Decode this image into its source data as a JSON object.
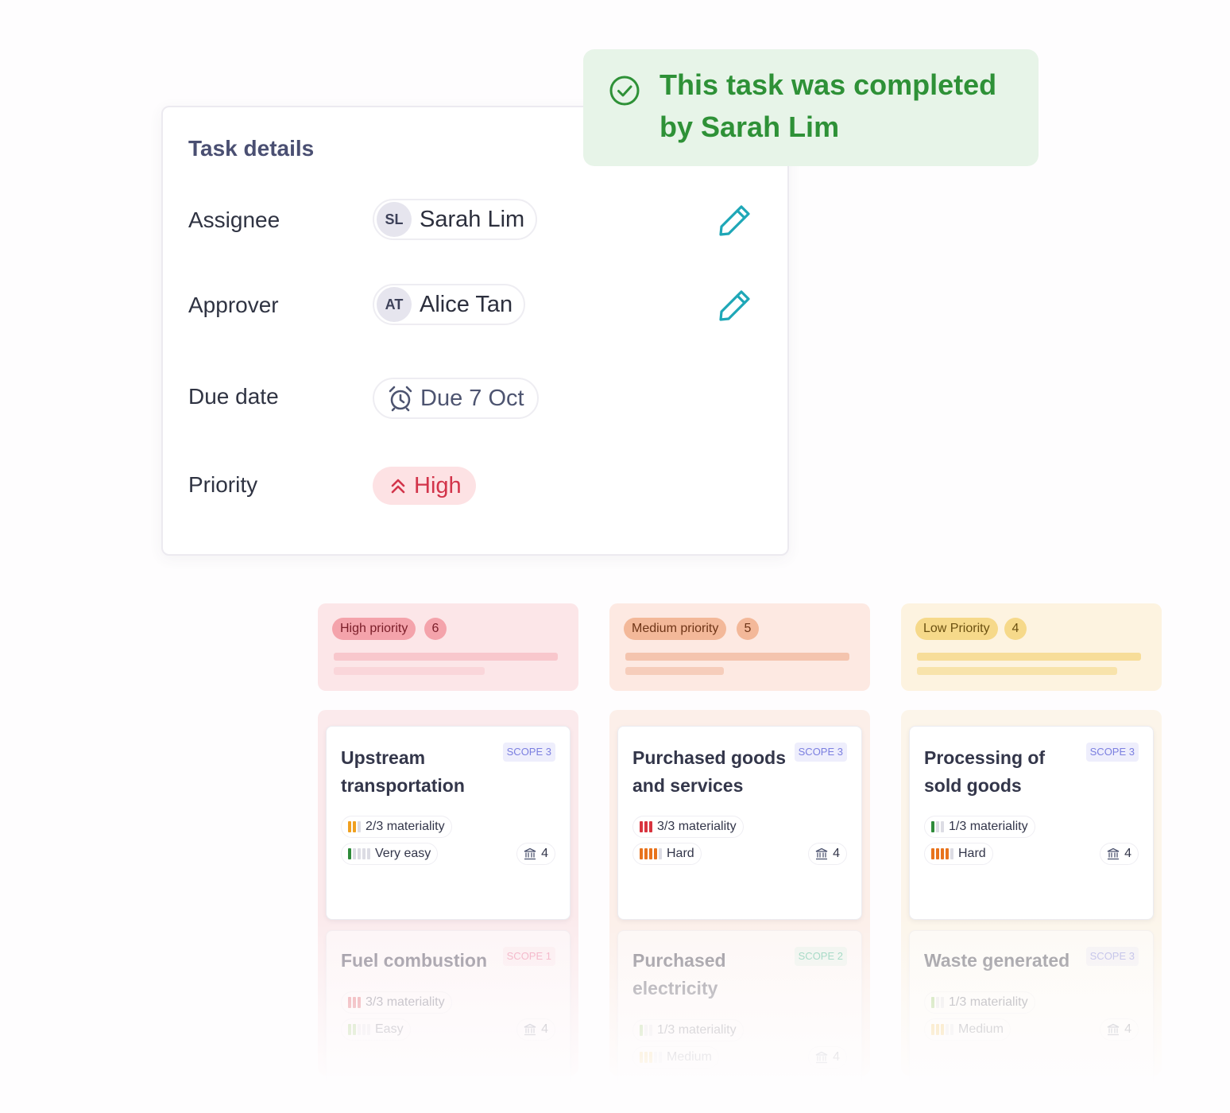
{
  "task_details": {
    "title": "Task details",
    "assignee": {
      "label": "Assignee",
      "initials": "SL",
      "name": "Sarah Lim"
    },
    "approver": {
      "label": "Approver",
      "initials": "AT",
      "name": "Alice Tan"
    },
    "due_date": {
      "label": "Due date",
      "value": "Due 7 Oct"
    },
    "priority": {
      "label": "Priority",
      "value": "High"
    }
  },
  "banner": {
    "text": "This task was completed by Sarah Lim"
  },
  "columns": [
    {
      "label": "High priority",
      "count": "6",
      "cards": [
        {
          "title": "Upstream transportation",
          "scope": "SCOPE 3",
          "materiality": "2/3 materiality",
          "difficulty": "Very easy",
          "count": "4"
        },
        {
          "title": "Fuel combustion",
          "scope": "SCOPE 1",
          "materiality": "3/3 materiality",
          "difficulty": "Easy",
          "count": "4"
        }
      ]
    },
    {
      "label": "Medium priority",
      "count": "5",
      "cards": [
        {
          "title": "Purchased goods and services",
          "scope": "SCOPE 3",
          "materiality": "3/3 materiality",
          "difficulty": "Hard",
          "count": "4"
        },
        {
          "title": "Purchased electricity",
          "scope": "SCOPE 2",
          "materiality": "1/3 materiality",
          "difficulty": "Medium",
          "count": "4"
        }
      ]
    },
    {
      "label": "Low Priority",
      "count": "4",
      "cards": [
        {
          "title": "Processing of sold goods",
          "scope": "SCOPE 3",
          "materiality": "1/3 materiality",
          "difficulty": "Hard",
          "count": "4"
        },
        {
          "title": "Waste generated",
          "scope": "SCOPE 3",
          "materiality": "1/3 materiality",
          "difficulty": "Medium",
          "count": "4"
        }
      ]
    }
  ],
  "colors": {
    "success_green": "#2e9137",
    "high_red": "#d2344a",
    "edit_teal": "#1ea7b7",
    "scope_purple": "#7b7fe0"
  },
  "icons": {
    "edit": "pencil-icon",
    "due": "alarm-clock-icon",
    "priority": "double-chevron-up-icon",
    "banner": "check-circle-icon",
    "org": "bank-icon"
  }
}
